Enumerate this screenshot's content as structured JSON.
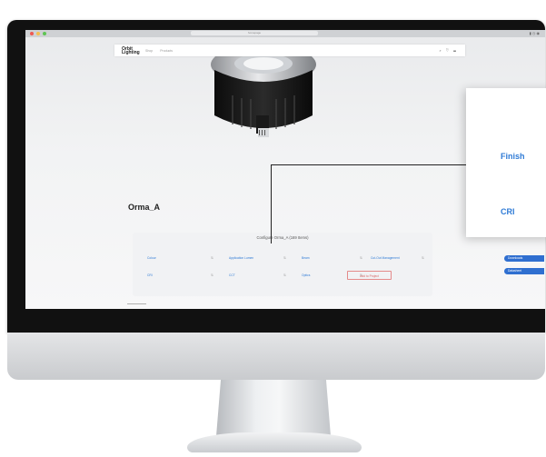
{
  "browser": {
    "url": "homepage"
  },
  "site": {
    "logo_text": "Orbit Lighting",
    "nav_items": [
      "Shop",
      "Products"
    ],
    "nav_icons": "⌕ ♡ ☰"
  },
  "product": {
    "title": "Orma_A"
  },
  "configurator": {
    "title": "Configure Orma_A (169 Items)",
    "row1": [
      "Colour",
      "Application Lumen",
      "Beam",
      "Cut-Out Management"
    ],
    "row2": [
      "CRI",
      "CCT",
      "Optics"
    ],
    "add_button": "Add to Project"
  },
  "side_buttons": [
    "Downloads",
    "Datasheet"
  ],
  "callout": {
    "options": [
      "Finish",
      "CRI"
    ]
  },
  "colors": {
    "accent": "#2f7bd6",
    "button": "#2f6fd0",
    "warning": "#d86464"
  }
}
